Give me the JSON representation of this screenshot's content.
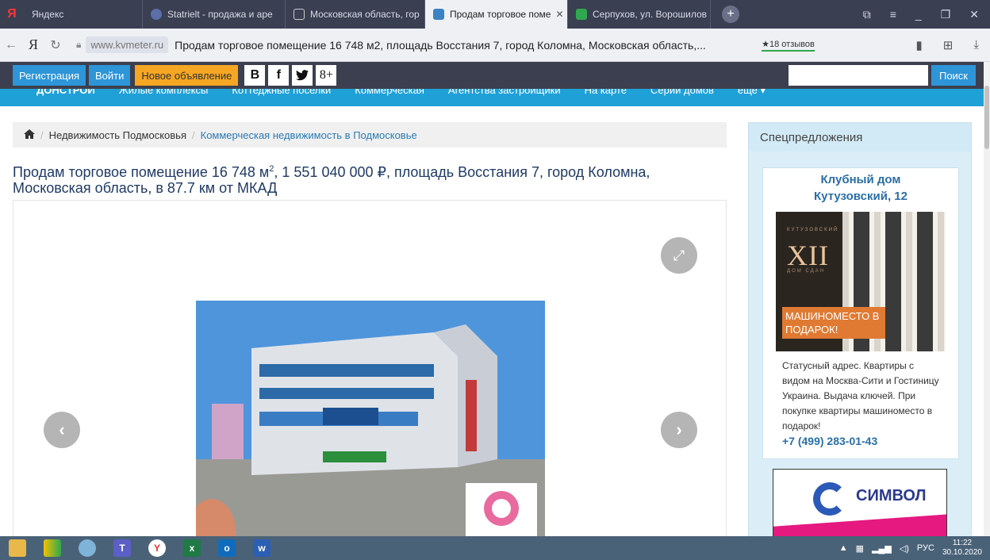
{
  "browser": {
    "tabs": [
      {
        "label": "Яндекс",
        "color": "#ff3333"
      },
      {
        "label": "Statrielt - продажа и аре",
        "color": "#5b6ea8"
      },
      {
        "label": "Московская область, гор",
        "color": "#dddddd"
      },
      {
        "label": "Продам торговое поме",
        "color": "#3b82c4",
        "active": true
      },
      {
        "label": "Серпухов, ул. Ворошилов",
        "color": "#2fa84f"
      }
    ],
    "url_domain": "www.kvmeter.ru",
    "url_title": "Продам торговое помещение 16 748 м2, площадь Восстания 7, город Коломна, Московская область,...",
    "reviews": "★18 отзывов"
  },
  "site_header": {
    "register_label": "Регистрация",
    "login_label": "Войти",
    "new_ad_label": "Новое объявление",
    "social": [
      "В",
      "f",
      "t",
      "8+"
    ],
    "search_value": "",
    "search_button": "Поиск"
  },
  "site_nav": {
    "items": [
      "ДОНСТРОЙ",
      "Жилые комплексы",
      "Коттеджные поселки",
      "Коммерческая",
      "Агентства застройщики",
      "На карте",
      "Серии домов",
      "еще ▾"
    ]
  },
  "breadcrumb": {
    "item1": "Недвижимость Подмосковья",
    "item2": "Коммерческая недвижимость в Подмосковье"
  },
  "listing": {
    "title_part1": "Продам торговое помещение 16 748 м",
    "title_sup": "2",
    "title_part2": ", 1 551 040 000 ₽, площадь Восстания 7, город Коломна, Московская область, в 87.7 км от МКАД"
  },
  "sidebar": {
    "title": "Спецпредложения",
    "ad1": {
      "title_line1": "Клубный дом",
      "title_line2": "Кутузовский, 12",
      "image_numeral": "XII",
      "image_caption_top": "КУТУЗОВСКИЙ",
      "image_caption_bottom": "ДОМ СДАН",
      "image_promo": "МАШИНОМЕСТО В ПОДАРОК!",
      "text": "Статусный адрес. Квартиры с видом на Москва-Сити и Гостиницу Украина. Выдача ключей. При покупке квартиры машиноместо в подарок!",
      "phone": "+7 (499) 283-01-43"
    },
    "ad2": {
      "brand": "СИМВОЛ"
    }
  },
  "taskbar": {
    "lang": "РУС",
    "time": "11:22",
    "date": "30.10.2020"
  }
}
